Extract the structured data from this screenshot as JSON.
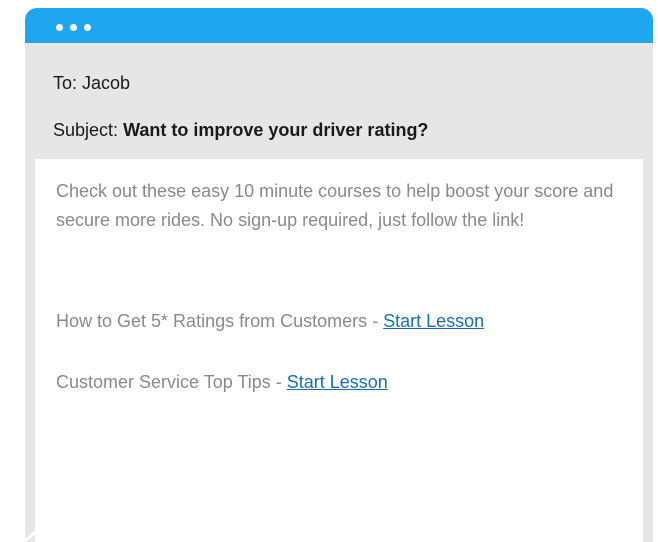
{
  "email": {
    "to_label": "To:",
    "to_name": "Jacob",
    "subject_label": "Subject:",
    "subject_text": "Want to improve your driver rating?",
    "body_paragraph": "Check out these easy 10 minute courses to help boost your score and secure more rides. No sign-up required, just follow the link!",
    "lessons": [
      {
        "title": "How to Get 5* Ratings from Customers -",
        "link_label": "Start Lesson"
      },
      {
        "title": "Customer Service Top Tips -",
        "link_label": "Start Lesson"
      }
    ]
  },
  "colors": {
    "titlebar": "#1ea7f0",
    "window_bg": "#e6e6e6",
    "body_text": "#8a8a8a",
    "link": "#1a6fb3"
  }
}
